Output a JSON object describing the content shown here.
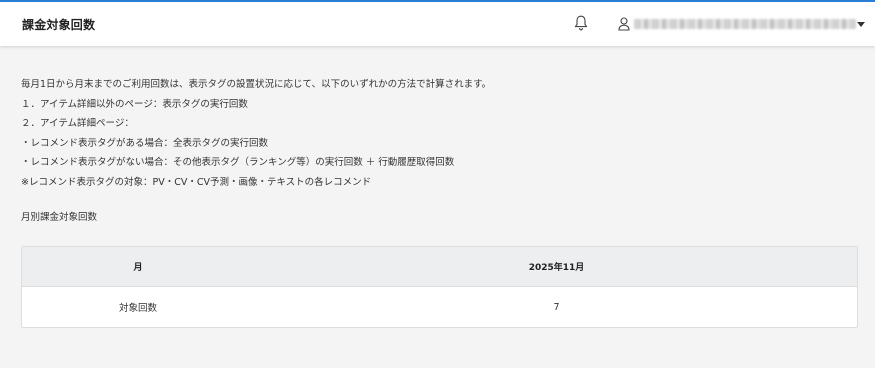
{
  "header": {
    "title": "課金対象回数",
    "bell_icon": "bell-icon",
    "user_icon": "user-icon",
    "user_menu_icon": "caret-down-icon"
  },
  "description": {
    "lines": [
      "毎月1日から月末までのご利用回数は、表示タグの設置状況に応じて、以下のいずれかの方法で計算されます。",
      "１．アイテム詳細以外のページ：表示タグの実行回数",
      "２．アイテム詳細ページ：",
      "・レコメンド表示タグがある場合：全表示タグの実行回数",
      "・レコメンド表示タグがない場合：その他表示タグ（ランキング等）の実行回数 ＋ 行動履歴取得回数",
      "※レコメンド表示タグの対象：PV・CV・CV予測・画像・テキストの各レコメンド"
    ]
  },
  "section": {
    "label": "月別課金対象回数"
  },
  "table": {
    "headers": [
      "月",
      "2025年11月"
    ],
    "rows": [
      [
        "対象回数",
        "7"
      ]
    ]
  },
  "colors": {
    "accent": "#2a7fd4",
    "background": "#f4f4f4",
    "table_header_bg": "#eceef0"
  }
}
